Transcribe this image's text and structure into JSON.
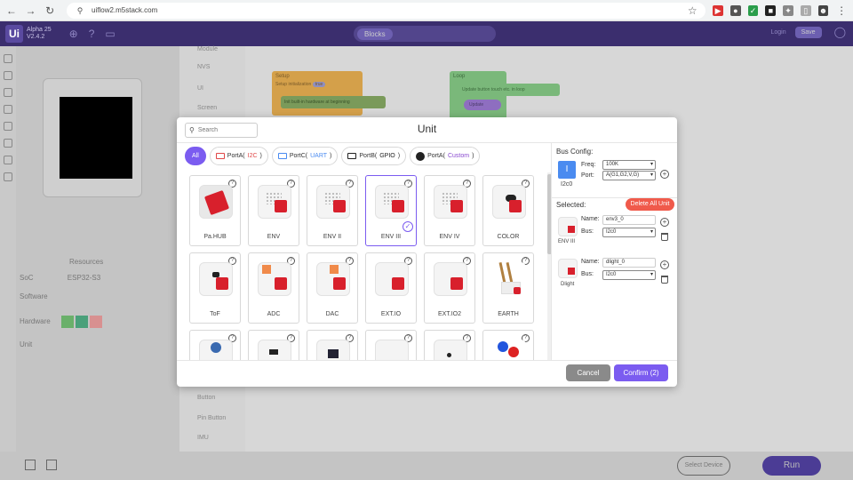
{
  "browser": {
    "url": "uiflow2.m5stack.com"
  },
  "app": {
    "logo": "Ui",
    "logo_name": "Alpha 25",
    "logo_version": "V2.4.2",
    "header_right_link": "Login",
    "header_right_button": "Save",
    "mode_active": "Blocks",
    "left_panel": {
      "resources_title": "Resources",
      "soc_label": "SoC",
      "soc_value": "ESP32-S3",
      "software_label": "Software",
      "hardware_label": "Hardware",
      "unit_label": "Unit"
    },
    "blocks": [
      "Module",
      "NVS",
      "UI",
      "Screen",
      "Button",
      "Pin Button",
      "IMU"
    ],
    "workspace": {
      "setup_title": "Setup",
      "setup_line1": "Setup initialization",
      "setup_badge": "true",
      "setup_line2": "Init built-in hardware at beginning",
      "loop_title": "Loop",
      "loop_line1": "Update button touch etc. in loop",
      "loop_badge": "Update"
    },
    "bottom": {
      "select_device": "Select Device",
      "run": "Run"
    }
  },
  "modal": {
    "title": "Unit",
    "search_placeholder": "Search",
    "filters": [
      {
        "label": "All",
        "active": true
      },
      {
        "prefix": "PortA(",
        "name": "I2C",
        "suffix": ")"
      },
      {
        "prefix": "PortC(",
        "name": "UART",
        "suffix": ")"
      },
      {
        "prefix": "PortB(",
        "name": "GPIO",
        "suffix": ")"
      },
      {
        "prefix": "PortA(",
        "name": "Custom",
        "suffix": ")"
      }
    ],
    "filter_colors": {
      "i2c": "#e04848",
      "uart": "#4a8bf0",
      "gpio": "#222222",
      "custom": "#8a4ad0"
    },
    "units_row1": [
      "Pa.HUB",
      "ENV",
      "ENV II",
      "ENV III",
      "ENV IV",
      "COLOR"
    ],
    "units_row2": [
      "ToF",
      "ADC",
      "DAC",
      "EXT.IO",
      "EXT.IO2",
      "EARTH"
    ],
    "selected_unit_index": 3,
    "bus_config": {
      "title": "Bus Config:",
      "chip_symbol": "I",
      "chip_label": "I2c0",
      "freq_label": "Freq:",
      "freq_value": "100K",
      "port_label": "Port:",
      "port_value": "A(G1,G2,V,G)"
    },
    "selected": {
      "title": "Selected:",
      "delete_all": "Delete All Unit",
      "items": [
        {
          "thumb_label": "ENV III",
          "name_label": "Name:",
          "name_value": "env3_0",
          "bus_label": "Bus:",
          "bus_value": "I2c0"
        },
        {
          "thumb_label": "Dlight",
          "name_label": "Name:",
          "name_value": "dlight_0",
          "bus_label": "Bus:",
          "bus_value": "I2c0"
        }
      ]
    },
    "cancel": "Cancel",
    "confirm": "Confirm (2)"
  },
  "colors": {
    "accent": "#7b5cf0",
    "danger": "#f05a4b",
    "header": "#3b2e6e"
  }
}
